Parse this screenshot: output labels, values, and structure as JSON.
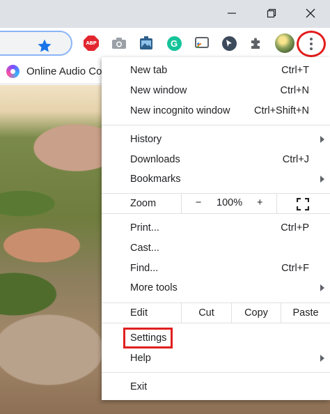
{
  "window": {
    "controls": [
      {
        "icon": "minimize-icon"
      },
      {
        "icon": "restore-icon"
      },
      {
        "icon": "close-icon"
      }
    ]
  },
  "toolbar": {
    "extensions": [
      {
        "icon": "adblock-plus-icon",
        "label": "ABP"
      },
      {
        "icon": "camera-icon"
      },
      {
        "icon": "screenshot-icon"
      },
      {
        "icon": "grammarly-icon",
        "label": "G"
      },
      {
        "icon": "cast-tab-icon"
      },
      {
        "icon": "cursor-icon"
      },
      {
        "icon": "extensions-puzzle-icon"
      }
    ],
    "bookmark_star_icon": "star-icon",
    "profile_icon": "avatar",
    "menu_icon": "kebab-menu-icon",
    "highlight_color": "#e41b1b"
  },
  "bookmarks": {
    "items": [
      {
        "label": "Online Audio Co",
        "icon": "audio-converter-icon"
      }
    ]
  },
  "menu": {
    "new_tab": {
      "label": "New tab",
      "shortcut": "Ctrl+T"
    },
    "new_window": {
      "label": "New window",
      "shortcut": "Ctrl+N"
    },
    "new_incognito": {
      "label": "New incognito window",
      "shortcut": "Ctrl+Shift+N"
    },
    "history": {
      "label": "History"
    },
    "downloads": {
      "label": "Downloads",
      "shortcut": "Ctrl+J"
    },
    "bookmarks": {
      "label": "Bookmarks"
    },
    "zoom": {
      "label": "Zoom",
      "minus": "−",
      "value": "100%",
      "plus": "+"
    },
    "print": {
      "label": "Print...",
      "shortcut": "Ctrl+P"
    },
    "cast": {
      "label": "Cast..."
    },
    "find": {
      "label": "Find...",
      "shortcut": "Ctrl+F"
    },
    "more_tools": {
      "label": "More tools"
    },
    "edit": {
      "label": "Edit",
      "cut": "Cut",
      "copy": "Copy",
      "paste": "Paste"
    },
    "settings": {
      "label": "Settings"
    },
    "help": {
      "label": "Help"
    },
    "exit": {
      "label": "Exit"
    }
  },
  "colors": {
    "highlight": "#e0201f",
    "star": "#1a73e8",
    "abp": "#e3262e",
    "grammarly": "#15c39a"
  }
}
